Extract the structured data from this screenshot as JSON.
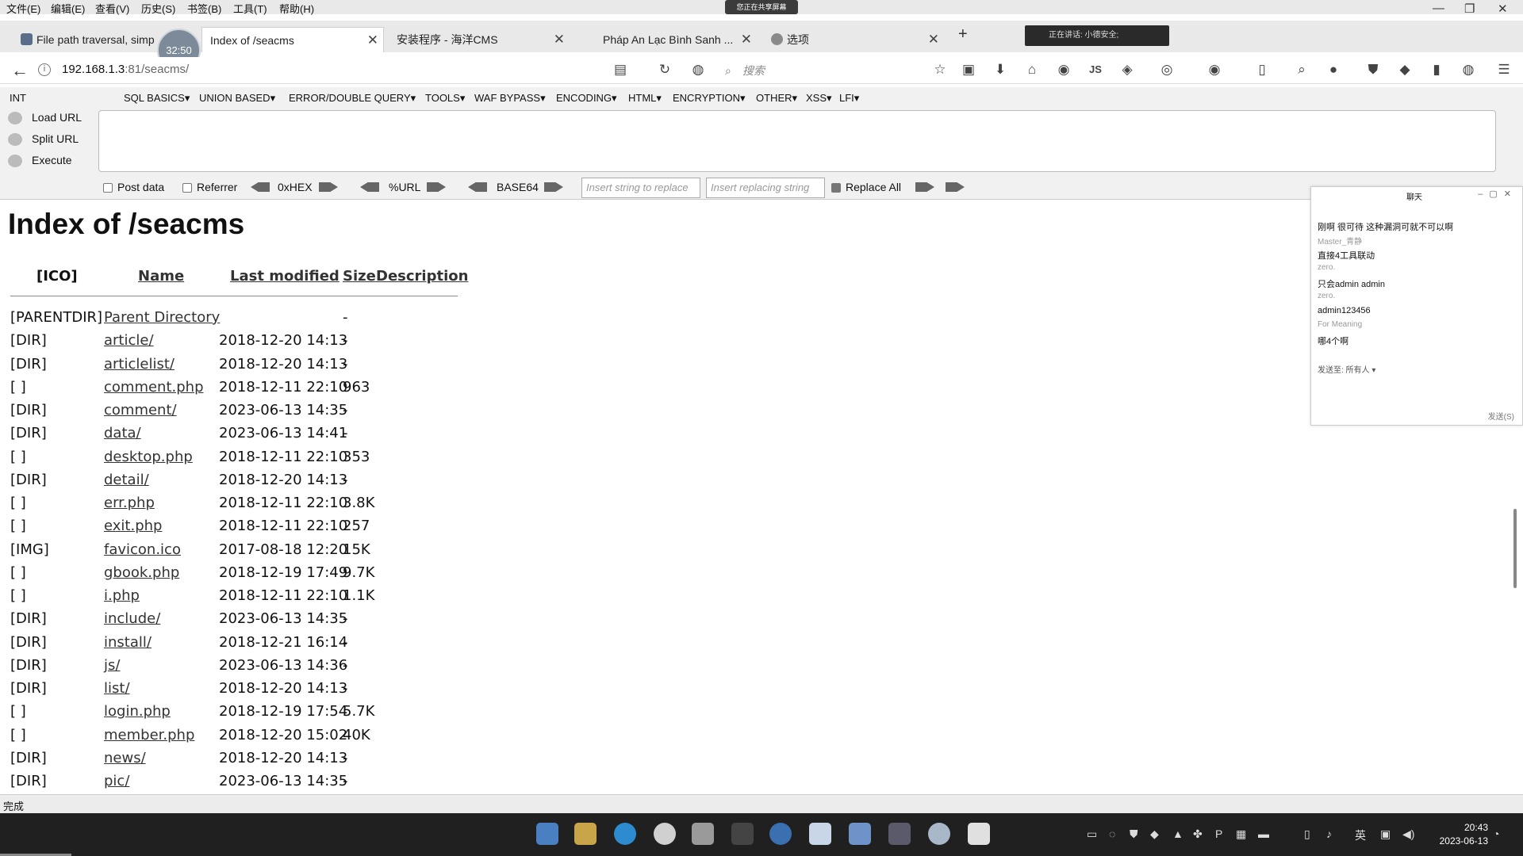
{
  "menubar": {
    "items": [
      "文件(E)",
      "编辑(E)",
      "查看(V)",
      "历史(S)",
      "书签(B)",
      "工具(T)",
      "帮助(H)"
    ],
    "share_banner": "您正在共享屏幕"
  },
  "timer": "32:50",
  "tabs": [
    {
      "label": "File path traversal, simp",
      "close": "✕"
    },
    {
      "label": "Index of /seacms",
      "close": "✕"
    },
    {
      "label": "安装程序 - 海洋CMS",
      "close": "✕"
    },
    {
      "label": "Pháp An Lạc Bình Sanh ...",
      "close": "✕"
    },
    {
      "label": "选项",
      "close": "✕"
    }
  ],
  "new_tab": "+",
  "voice_pill": "正在讲话: 小德安全;",
  "nav": {
    "url_host": "192.168.1.3",
    "url_port": ":81",
    "url_path": "/seacms/",
    "search_placeholder": "搜索",
    "icons": [
      "star-icon",
      "reader-icon",
      "download-icon",
      "home-icon",
      "globe-icon",
      "js-icon",
      "extension-icon",
      "menu-icon"
    ]
  },
  "hackbar": {
    "int_label": "INT",
    "menu": [
      "SQL BASICS▾",
      "UNION BASED▾",
      "ERROR/DOUBLE QUERY▾",
      "TOOLS▾",
      "WAF BYPASS▾",
      "ENCODING▾",
      "HTML▾",
      "ENCRYPTION▾",
      "OTHER▾",
      "XSS▾",
      "LFI▾"
    ],
    "load_url": "Load URL",
    "split_url": "Split URL",
    "execute": "Execute",
    "post_data": "Post data",
    "referrer": "Referrer",
    "hex": "0xHEX",
    "url": "%URL",
    "base64": "BASE64",
    "insert_placeholder": "Insert string to replace",
    "replacing_placeholder": "Insert replacing string",
    "replace_all": "Replace All"
  },
  "page": {
    "title": "Index of /seacms",
    "headers": {
      "ico": "[ICO]",
      "name": "Name",
      "modified": "Last modified",
      "size": "Size",
      "description": "Description"
    },
    "rows": [
      {
        "icon": "[PARENTDIR]",
        "name": "Parent Directory",
        "date": "",
        "size": "-"
      },
      {
        "icon": "[DIR]",
        "name": "article/",
        "date": "2018-12-20 14:13",
        "size": "-"
      },
      {
        "icon": "[DIR]",
        "name": "articlelist/",
        "date": "2018-12-20 14:13",
        "size": "-"
      },
      {
        "icon": "[ ]",
        "name": "comment.php",
        "date": "2018-12-11 22:10",
        "size": "963"
      },
      {
        "icon": "[DIR]",
        "name": "comment/",
        "date": "2023-06-13 14:35",
        "size": "-"
      },
      {
        "icon": "[DIR]",
        "name": "data/",
        "date": "2023-06-13 14:41",
        "size": "-"
      },
      {
        "icon": "[ ]",
        "name": "desktop.php",
        "date": "2018-12-11 22:10",
        "size": "353"
      },
      {
        "icon": "[DIR]",
        "name": "detail/",
        "date": "2018-12-20 14:13",
        "size": "-"
      },
      {
        "icon": "[ ]",
        "name": "err.php",
        "date": "2018-12-11 22:10",
        "size": "3.8K"
      },
      {
        "icon": "[ ]",
        "name": "exit.php",
        "date": "2018-12-11 22:10",
        "size": "257"
      },
      {
        "icon": "[IMG]",
        "name": "favicon.ico",
        "date": "2017-08-18 12:20",
        "size": "15K"
      },
      {
        "icon": "[ ]",
        "name": "gbook.php",
        "date": "2018-12-19 17:49",
        "size": "9.7K"
      },
      {
        "icon": "[ ]",
        "name": "i.php",
        "date": "2018-12-11 22:10",
        "size": "1.1K"
      },
      {
        "icon": "[DIR]",
        "name": "include/",
        "date": "2023-06-13 14:35",
        "size": "-"
      },
      {
        "icon": "[DIR]",
        "name": "install/",
        "date": "2018-12-21 16:14",
        "size": "-"
      },
      {
        "icon": "[DIR]",
        "name": "js/",
        "date": "2023-06-13 14:36",
        "size": "-"
      },
      {
        "icon": "[DIR]",
        "name": "list/",
        "date": "2018-12-20 14:13",
        "size": "-"
      },
      {
        "icon": "[ ]",
        "name": "login.php",
        "date": "2018-12-19 17:54",
        "size": "5.7K"
      },
      {
        "icon": "[ ]",
        "name": "member.php",
        "date": "2018-12-20 15:02",
        "size": "40K"
      },
      {
        "icon": "[DIR]",
        "name": "news/",
        "date": "2018-12-20 14:13",
        "size": "-"
      },
      {
        "icon": "[DIR]",
        "name": "pic/",
        "date": "2023-06-13 14:35",
        "size": "-"
      }
    ]
  },
  "chat": {
    "title": "聊天",
    "messages": [
      {
        "text": "刚啊  很可待 这种漏洞可就不可以啊",
        "who": false
      },
      {
        "text": "Master_青静",
        "who": true
      },
      {
        "text": "直接4工具联动",
        "who": false
      },
      {
        "text": "zero.",
        "who": true
      },
      {
        "text": "只会admin admin",
        "who": false
      },
      {
        "text": "zero.",
        "who": true
      },
      {
        "text": "admin123456",
        "who": false
      },
      {
        "text": "For Meaning",
        "who": true
      },
      {
        "text": "哪4个啊",
        "who": false
      }
    ],
    "send_to": "发送至:   所有人 ▾",
    "send_button": "发送(S)"
  },
  "status": "完成",
  "clock": {
    "time": "20:43",
    "date": "2023-06-13"
  },
  "tray_ime": "英",
  "colors": {
    "taskbar": "#202020",
    "chrome": "#e9e9e9",
    "hackbar": "#f1f1f1"
  }
}
